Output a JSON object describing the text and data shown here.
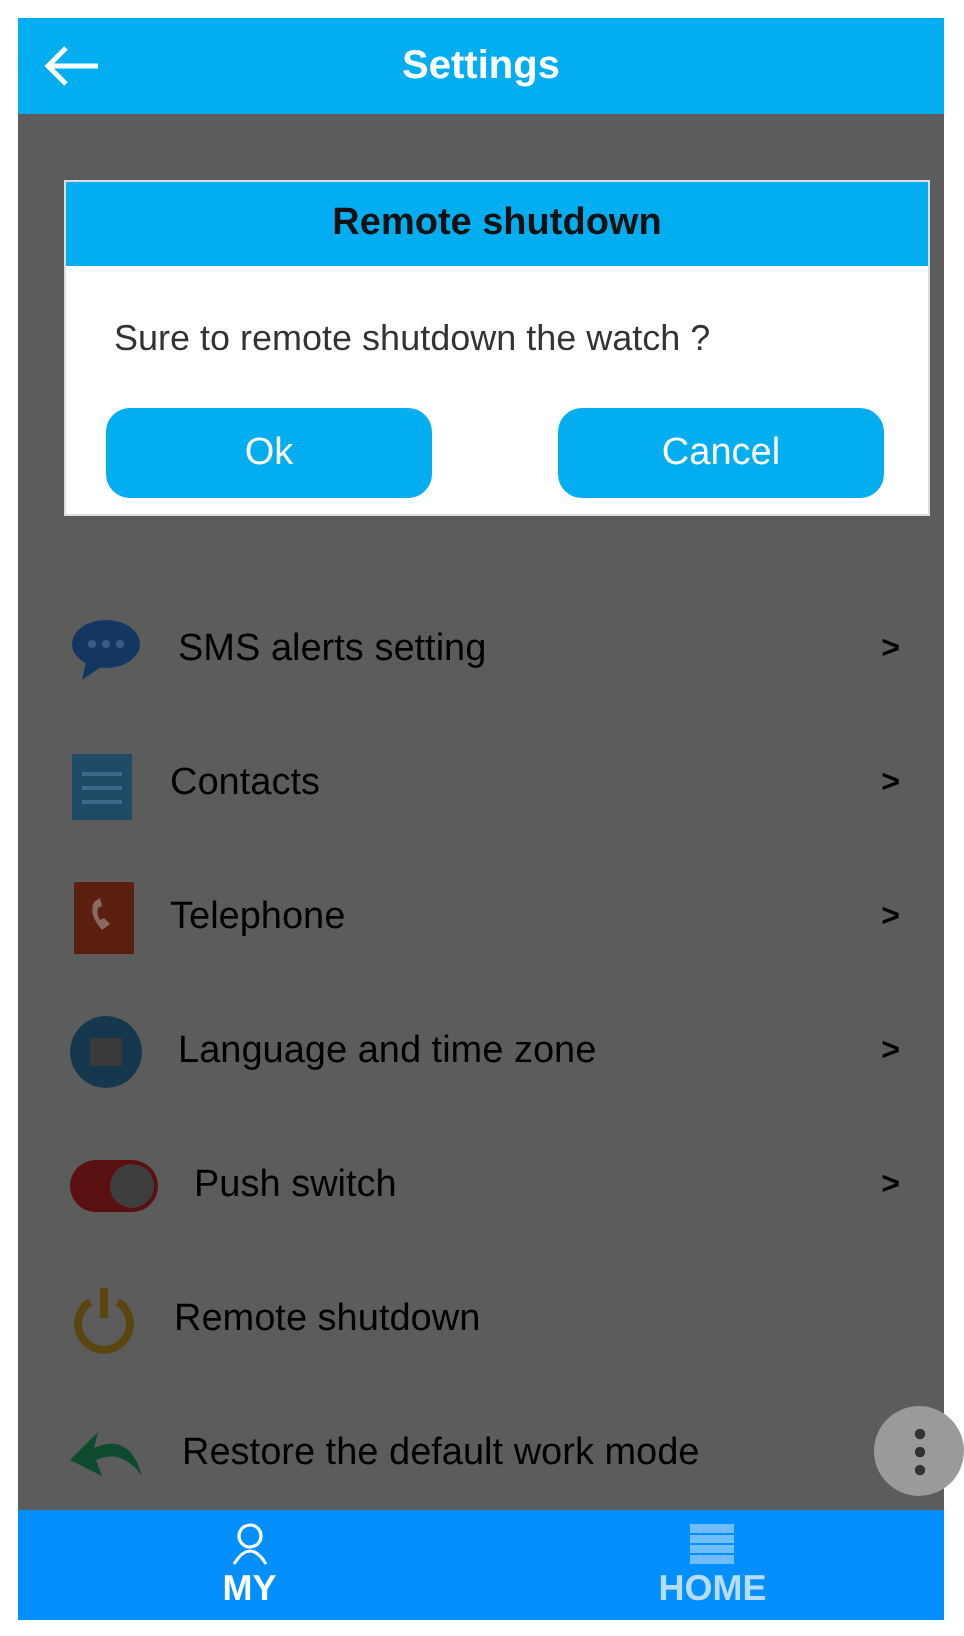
{
  "header": {
    "title": "Settings"
  },
  "settings": [
    {
      "kind": "hidden"
    },
    {
      "kind": "hidden"
    },
    {
      "kind": "hidden"
    },
    {
      "kind": "hidden"
    },
    {
      "kind": "link",
      "label": "SMS alerts setting",
      "chevron": ">"
    },
    {
      "kind": "link",
      "label": "Contacts",
      "chevron": ">"
    },
    {
      "kind": "link",
      "label": "Telephone",
      "chevron": ">"
    },
    {
      "kind": "link",
      "label": "Language and time zone",
      "chevron": ">"
    },
    {
      "kind": "link",
      "label": "Push switch",
      "chevron": ">"
    },
    {
      "kind": "plain",
      "label": "Remote shutdown"
    },
    {
      "kind": "plain",
      "label": "Restore the default work mode"
    }
  ],
  "dialog": {
    "title": "Remote shutdown",
    "message": "Sure to remote shutdown the watch ?",
    "buttons": [
      "Ok",
      "Cancel"
    ]
  },
  "bottom_nav": [
    {
      "label": "MY",
      "selected": true
    },
    {
      "label": "HOME",
      "selected": false
    }
  ]
}
